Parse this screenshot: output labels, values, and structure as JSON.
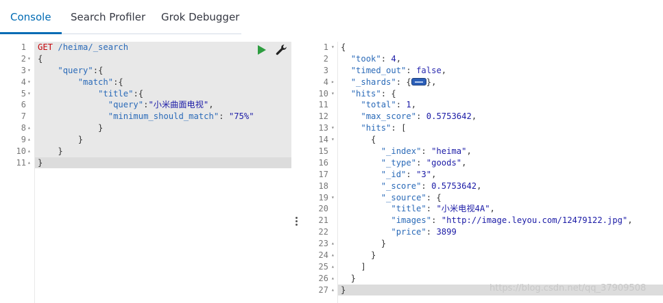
{
  "tabs": [
    {
      "label": "Console"
    },
    {
      "label": "Search Profiler"
    },
    {
      "label": "Grok Debugger"
    }
  ],
  "request": {
    "lines": [
      {
        "n": "1",
        "fold": "",
        "parts": [
          [
            "method",
            "GET"
          ],
          [
            "punct",
            " "
          ],
          [
            "url",
            "/heima/_search"
          ]
        ]
      },
      {
        "n": "2",
        "fold": "▾",
        "parts": [
          [
            "punct",
            "{"
          ]
        ]
      },
      {
        "n": "3",
        "fold": "▾",
        "parts": [
          [
            "punct",
            "    "
          ],
          [
            "key",
            "\"query\""
          ],
          [
            "punct",
            ":{"
          ]
        ]
      },
      {
        "n": "4",
        "fold": "▾",
        "parts": [
          [
            "punct",
            "        "
          ],
          [
            "key",
            "\"match\""
          ],
          [
            "punct",
            ":{"
          ]
        ]
      },
      {
        "n": "5",
        "fold": "▾",
        "parts": [
          [
            "punct",
            "            "
          ],
          [
            "key",
            "\"title\""
          ],
          [
            "punct",
            ":{"
          ]
        ]
      },
      {
        "n": "6",
        "fold": "",
        "parts": [
          [
            "punct",
            "              "
          ],
          [
            "key",
            "\"query\""
          ],
          [
            "punct",
            ":"
          ],
          [
            "s",
            "\"小米曲面电视\""
          ],
          [
            "punct",
            ","
          ]
        ]
      },
      {
        "n": "7",
        "fold": "",
        "parts": [
          [
            "punct",
            "              "
          ],
          [
            "key",
            "\"minimum_should_match\""
          ],
          [
            "punct",
            ": "
          ],
          [
            "s",
            "\"75%\""
          ]
        ]
      },
      {
        "n": "8",
        "fold": "▴",
        "parts": [
          [
            "punct",
            "            }"
          ]
        ]
      },
      {
        "n": "9",
        "fold": "▴",
        "parts": [
          [
            "punct",
            "        }"
          ]
        ]
      },
      {
        "n": "10",
        "fold": "▴",
        "parts": [
          [
            "punct",
            "    }"
          ]
        ]
      },
      {
        "n": "11",
        "fold": "▴",
        "parts": [
          [
            "punct",
            "}"
          ]
        ]
      }
    ]
  },
  "response": {
    "lines": [
      {
        "n": "1",
        "fold": "▾",
        "parts": [
          [
            "punct",
            "{"
          ]
        ]
      },
      {
        "n": "2",
        "fold": "",
        "parts": [
          [
            "punct",
            "  "
          ],
          [
            "key",
            "\"took\""
          ],
          [
            "punct",
            ": "
          ],
          [
            "num",
            "4"
          ],
          [
            "punct",
            ","
          ]
        ]
      },
      {
        "n": "3",
        "fold": "",
        "parts": [
          [
            "punct",
            "  "
          ],
          [
            "key",
            "\"timed_out\""
          ],
          [
            "punct",
            ": "
          ],
          [
            "kw",
            "false"
          ],
          [
            "punct",
            ","
          ]
        ]
      },
      {
        "n": "4",
        "fold": "▸",
        "parts": [
          [
            "punct",
            "  "
          ],
          [
            "key",
            "\"_shards\""
          ],
          [
            "punct",
            ": {"
          ],
          [
            "widget",
            ""
          ],
          [
            "punct",
            "},"
          ]
        ]
      },
      {
        "n": "10",
        "fold": "▾",
        "parts": [
          [
            "punct",
            "  "
          ],
          [
            "key",
            "\"hits\""
          ],
          [
            "punct",
            ": {"
          ]
        ]
      },
      {
        "n": "11",
        "fold": "",
        "parts": [
          [
            "punct",
            "    "
          ],
          [
            "key",
            "\"total\""
          ],
          [
            "punct",
            ": "
          ],
          [
            "num",
            "1"
          ],
          [
            "punct",
            ","
          ]
        ]
      },
      {
        "n": "12",
        "fold": "",
        "parts": [
          [
            "punct",
            "    "
          ],
          [
            "key",
            "\"max_score\""
          ],
          [
            "punct",
            ": "
          ],
          [
            "num",
            "0.5753642"
          ],
          [
            "punct",
            ","
          ]
        ]
      },
      {
        "n": "13",
        "fold": "▾",
        "parts": [
          [
            "punct",
            "    "
          ],
          [
            "key",
            "\"hits\""
          ],
          [
            "punct",
            ": ["
          ]
        ]
      },
      {
        "n": "14",
        "fold": "▾",
        "parts": [
          [
            "punct",
            "      {"
          ]
        ]
      },
      {
        "n": "15",
        "fold": "",
        "parts": [
          [
            "punct",
            "        "
          ],
          [
            "key",
            "\"_index\""
          ],
          [
            "punct",
            ": "
          ],
          [
            "s",
            "\"heima\""
          ],
          [
            "punct",
            ","
          ]
        ]
      },
      {
        "n": "16",
        "fold": "",
        "parts": [
          [
            "punct",
            "        "
          ],
          [
            "key",
            "\"_type\""
          ],
          [
            "punct",
            ": "
          ],
          [
            "s",
            "\"goods\""
          ],
          [
            "punct",
            ","
          ]
        ]
      },
      {
        "n": "17",
        "fold": "",
        "parts": [
          [
            "punct",
            "        "
          ],
          [
            "key",
            "\"_id\""
          ],
          [
            "punct",
            ": "
          ],
          [
            "s",
            "\"3\""
          ],
          [
            "punct",
            ","
          ]
        ]
      },
      {
        "n": "18",
        "fold": "",
        "parts": [
          [
            "punct",
            "        "
          ],
          [
            "key",
            "\"_score\""
          ],
          [
            "punct",
            ": "
          ],
          [
            "num",
            "0.5753642"
          ],
          [
            "punct",
            ","
          ]
        ]
      },
      {
        "n": "19",
        "fold": "▾",
        "parts": [
          [
            "punct",
            "        "
          ],
          [
            "key",
            "\"_source\""
          ],
          [
            "punct",
            ": {"
          ]
        ]
      },
      {
        "n": "20",
        "fold": "",
        "parts": [
          [
            "punct",
            "          "
          ],
          [
            "key",
            "\"title\""
          ],
          [
            "punct",
            ": "
          ],
          [
            "s",
            "\"小米电视4A\""
          ],
          [
            "punct",
            ","
          ]
        ]
      },
      {
        "n": "21",
        "fold": "",
        "parts": [
          [
            "punct",
            "          "
          ],
          [
            "key",
            "\"images\""
          ],
          [
            "punct",
            ": "
          ],
          [
            "s",
            "\"http://image.leyou.com/12479122.jpg\""
          ],
          [
            "punct",
            ","
          ]
        ]
      },
      {
        "n": "22",
        "fold": "",
        "parts": [
          [
            "punct",
            "          "
          ],
          [
            "key",
            "\"price\""
          ],
          [
            "punct",
            ": "
          ],
          [
            "num",
            "3899"
          ]
        ]
      },
      {
        "n": "23",
        "fold": "▴",
        "parts": [
          [
            "punct",
            "        }"
          ]
        ]
      },
      {
        "n": "24",
        "fold": "▴",
        "parts": [
          [
            "punct",
            "      }"
          ]
        ]
      },
      {
        "n": "25",
        "fold": "▴",
        "parts": [
          [
            "punct",
            "    ]"
          ]
        ]
      },
      {
        "n": "26",
        "fold": "▴",
        "parts": [
          [
            "punct",
            "  }"
          ]
        ]
      },
      {
        "n": "27",
        "fold": "▴",
        "parts": [
          [
            "punct",
            "}"
          ]
        ]
      }
    ]
  },
  "watermark": "https://blog.csdn.net/qq_37909508",
  "colors": {
    "accent": "#006bb4",
    "play": "#2e9d40",
    "method": "#c5060b"
  }
}
